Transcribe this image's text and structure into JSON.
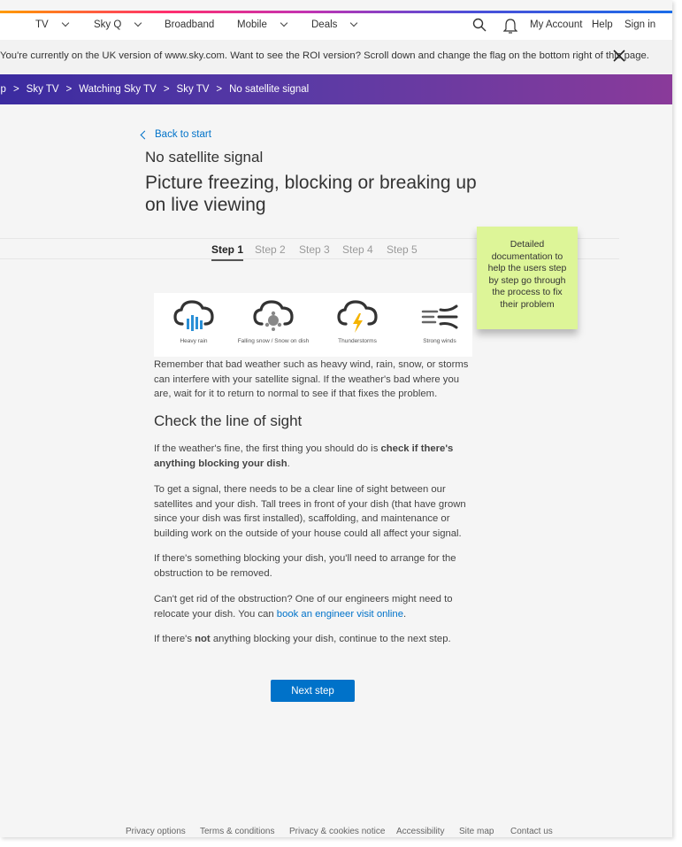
{
  "nav": {
    "items": [
      {
        "label": "TV",
        "dropdown": true
      },
      {
        "label": "Sky Q",
        "dropdown": true
      },
      {
        "label": "Broadband",
        "dropdown": false
      },
      {
        "label": "Mobile",
        "dropdown": true
      },
      {
        "label": "Deals",
        "dropdown": true
      }
    ],
    "icons": [
      "search-icon",
      "bell-icon"
    ],
    "right_links": [
      "My Account",
      "Help",
      "Sign in"
    ]
  },
  "notice": {
    "text": "You're currently on the UK version of www.sky.com. Want to see the ROI version? Scroll down and change the flag on the bottom right of this page.",
    "close_icon": "close-icon"
  },
  "breadcrumb": [
    "lp",
    "Sky TV",
    "Watching Sky TV",
    "Sky TV",
    "No satellite signal"
  ],
  "breadcrumb_separator": ">",
  "back_link": "Back to start",
  "subtitle": "No satellite signal",
  "title": "Picture freezing, blocking or breaking up on live viewing",
  "steps": [
    "Step 1",
    "Step 2",
    "Step 3",
    "Step 4",
    "Step 5"
  ],
  "active_step": 1,
  "sticky_note": "Detailed documentation to help the users step by step go through the process to fix their problem",
  "weather": [
    {
      "label": "Heavy rain",
      "icon": "heavy-rain-icon"
    },
    {
      "label": "Falling snow / Snow on dish",
      "icon": "snow-icon"
    },
    {
      "label": "Thunderstorms",
      "icon": "thunderstorm-icon"
    },
    {
      "label": "Strong winds",
      "icon": "strong-winds-icon"
    }
  ],
  "content": {
    "intro": "Remember that bad weather such as heavy wind, rain, snow, or storms can interfere with your satellite signal. If the weather's bad where you are, wait for it to return to normal to see if that fixes the problem.",
    "section_heading": "Check the line of sight",
    "p1_pre": "If the weather's fine, the first thing you should do is ",
    "p1_bold": "check if there's anything blocking your dish",
    "p1_post": ".",
    "p2": "To get a signal, there needs to be a clear line of sight between our satellites and your dish. Tall trees in front of your dish (that have grown since your dish was first installed), scaffolding, and maintenance or building work on the outside of your house could all affect your signal.",
    "p3": "If there's something blocking your dish, you'll need to arrange for the obstruction to be removed.",
    "p4_pre": "Can't get rid of the obstruction? One of our engineers might need to relocate your dish. You can ",
    "p4_link": "book an engineer visit online",
    "p4_post": ".",
    "p5_pre": "If there's ",
    "p5_bold": "not",
    "p5_post": " anything blocking your dish, continue to the next step."
  },
  "next_button": "Next step",
  "footer": [
    "Privacy options",
    "Terms & conditions",
    "Privacy & cookies notice",
    "Accessibility",
    "Site map",
    "Contact us"
  ],
  "colors": {
    "accent": "#0072c9",
    "sticky": "#ddf598",
    "breadcrumb_start": "#3b2ba0",
    "breadcrumb_end": "#8a3a9a"
  }
}
